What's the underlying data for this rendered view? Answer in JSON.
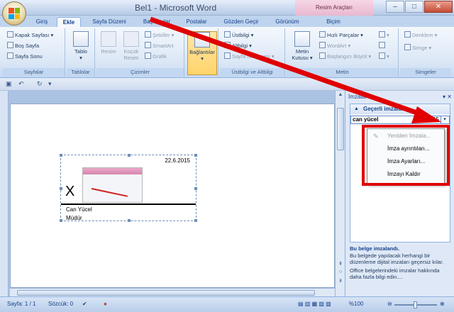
{
  "app": {
    "title": "Bel1 - Microsoft Word",
    "contextual_tab_title": "Resim Araçları",
    "window_controls": [
      "–",
      "□",
      "✕"
    ]
  },
  "tabs": [
    {
      "label": "Giriş"
    },
    {
      "label": "Ekle",
      "active": true
    },
    {
      "label": "Sayfa Düzeni"
    },
    {
      "label": "Başvurular"
    },
    {
      "label": "Postalar"
    },
    {
      "label": "Gözden Geçir"
    },
    {
      "label": "Görünüm"
    },
    {
      "label": "Biçim"
    }
  ],
  "ribbon": {
    "sayfalar": {
      "label": "Sayfalar",
      "items": [
        "Kapak Sayfası ▾",
        "Boş Sayfa",
        "Sayfa Sonu"
      ]
    },
    "tablolar": {
      "label": "Tablolar",
      "tablo": "Tablo"
    },
    "cizimler": {
      "label": "Çizimler",
      "resim": "Resim",
      "kucuk_resim": "Küçük Resim",
      "sekiller": "Şekiller ▾",
      "smartart": "SmartArt",
      "grafik": "Grafik"
    },
    "baglantilar": {
      "label": "Bağlantılar"
    },
    "ustbilgi": {
      "label": "Üstbilgi ve Altbilgi",
      "items": [
        "Üstbilgi ▾",
        "Altbilgi ▾",
        "Sayfa Numarası ▾"
      ]
    },
    "metin": {
      "label": "Metin",
      "metin_kutusu": "Metin Kutusu ▾",
      "items": [
        "Hızlı Parçalar ▾",
        "WordArt ▾",
        "Başlangıcı Büyüt ▾"
      ]
    },
    "simgeler": {
      "label": "Simgeler",
      "items": [
        "Denklem ▾",
        "Simge ▾"
      ]
    }
  },
  "document": {
    "signature": {
      "date": "22.6.2015",
      "x_mark": "X",
      "name": "Can Yücel",
      "title": "Müdür"
    }
  },
  "pane": {
    "title": "İmzalar",
    "controls": "▾ ✕",
    "section": "Geçerli imzalar:",
    "entry": {
      "name": "can yücel",
      "date": "22.6.2015",
      "dropdown": "▾"
    },
    "menu": [
      {
        "label": "Yeniden İmzala...",
        "disabled": true
      },
      {
        "label": "İmza ayrıntıları..."
      },
      {
        "label": "İmza Ayarları..."
      },
      {
        "label": "İmzayı Kaldır"
      }
    ],
    "info_title": "Bu belge imzalandı.",
    "info_text": "Bu belgede yapılacak herhangi bir düzenleme dijital imzaları geçersiz kılar.",
    "info_link": "Office belgelerindeki imzalar hakkında daha fazla bilgi edin...."
  },
  "status": {
    "page": "Sayfa: 1 / 1",
    "words": "Sözcük: 0",
    "zoom": "%100"
  },
  "annotation": {
    "color": "#e00000"
  }
}
